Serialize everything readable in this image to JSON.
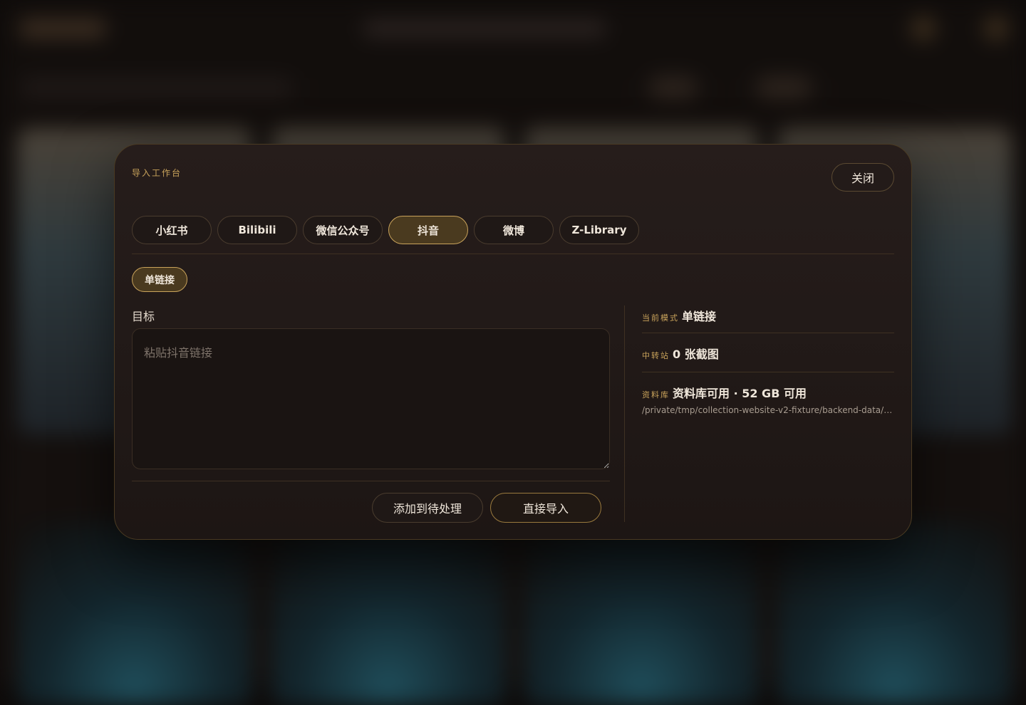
{
  "modal": {
    "eyebrow": "导入工作台",
    "close_label": "关闭",
    "tabs": [
      {
        "label": "小红书",
        "active": false
      },
      {
        "label": "Bilibili",
        "active": false
      },
      {
        "label": "微信公众号",
        "active": false
      },
      {
        "label": "抖音",
        "active": true
      },
      {
        "label": "微博",
        "active": false
      },
      {
        "label": "Z-Library",
        "active": false
      }
    ],
    "mode_chip": "单链接",
    "target_label": "目标",
    "target_placeholder": "粘贴抖音链接",
    "target_value": "",
    "queue_button": "添加到待处理",
    "import_button": "直接导入",
    "info": {
      "mode_key": "当前模式",
      "mode_value": "单链接",
      "relay_key": "中转站",
      "relay_value": "0 张截图",
      "library_key": "资料库",
      "library_value": "资料库可用 · 52 GB 可用",
      "library_path": "/private/tmp/collection-website-v2-fixture/backend-data/…"
    }
  },
  "colors": {
    "accent": "#c9a35b",
    "modal_bg": "#221a18",
    "active_tab_bg": "#4a3a1f",
    "text": "#efe6da"
  }
}
